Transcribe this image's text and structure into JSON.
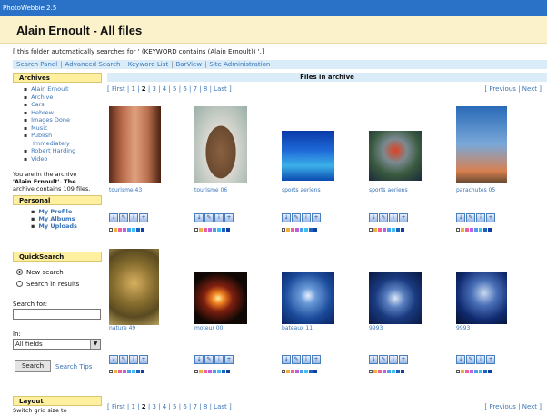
{
  "app": {
    "title": "PhotoWebbie 2.5"
  },
  "header": {
    "title": "Alain Ernoult - All files"
  },
  "notice": "[ this folder automatically searches for ' (KEYWORD contains (Alain Ernoult)) '.]",
  "nav": {
    "items": [
      "Search Panel",
      "Advanced Search",
      "Keyword List",
      "BarView",
      "Site Administration"
    ]
  },
  "sidebar": {
    "archives_title": "Archives",
    "archives": [
      {
        "label": "Alain Ernoult",
        "cont": false
      },
      {
        "label": "Archive",
        "cont": false
      },
      {
        "label": "Cars",
        "cont": false
      },
      {
        "label": "Hebrew",
        "cont": false
      },
      {
        "label": "Images Done",
        "cont": false
      },
      {
        "label": "Music",
        "cont": false
      },
      {
        "label": "Publish",
        "cont": false
      },
      {
        "label": "Immediately",
        "cont": true
      },
      {
        "label": "Robert Harding",
        "cont": false
      },
      {
        "label": "Video",
        "cont": false
      }
    ],
    "archive_info_1": "You are in the archive",
    "archive_info_2": "'Alain Ernoult'. The",
    "archive_info_3": "archive contains 109 files.",
    "personal_title": "Personal",
    "personal": [
      "My Profile",
      "My Albums",
      "My Uploads"
    ],
    "quicksearch_title": "QuickSearch",
    "radio_new": "New search",
    "radio_results": "Search in results",
    "search_for_label": "Search for:",
    "search_value": "",
    "in_label": "In:",
    "in_value": "All fields",
    "search_button": "Search",
    "search_tips": "Search Tips",
    "layout_title": "Layout",
    "layout_text": "Switch grid size to"
  },
  "main": {
    "title": "Files in archive",
    "pager_top": {
      "first": "First",
      "pages": [
        "1",
        "2",
        "3",
        "4",
        "5",
        "6",
        "7",
        "8"
      ],
      "current": "2",
      "last": "Last"
    },
    "pager_bottom": {
      "first": "First",
      "pages": [
        "1",
        "2",
        "3",
        "4",
        "5",
        "6",
        "7",
        "8"
      ],
      "current": "2",
      "last": "Last"
    },
    "previous": "Previous",
    "next": "Next",
    "files": [
      {
        "caption": "tourisme 43",
        "thumb": "petra-treasury"
      },
      {
        "caption": "tourisme 06",
        "thumb": "man-portrait"
      },
      {
        "caption": "sports aeriens",
        "thumb": "skydive-sea"
      },
      {
        "caption": "sports aeriens",
        "thumb": "hang-glider"
      },
      {
        "caption": "parachutes 05",
        "thumb": "parachute-sky"
      },
      {
        "caption": "nature 49",
        "thumb": "cactus"
      },
      {
        "caption": "moteur 00",
        "thumb": "fire-car"
      },
      {
        "caption": "bateaux 11",
        "thumb": "sailboat"
      },
      {
        "caption": "9993",
        "thumb": "jet-cockpit"
      },
      {
        "caption": "9993",
        "thumb": "jet-pilot"
      }
    ],
    "swatch_colors": [
      "#ffffff",
      "#f0b040",
      "#f060a0",
      "#c060e0",
      "#4aa0f0",
      "#40c0f0",
      "#2060c0",
      "#1040a0"
    ],
    "icon_names": [
      "download-icon",
      "edit-icon",
      "info-icon",
      "add-icon"
    ]
  }
}
